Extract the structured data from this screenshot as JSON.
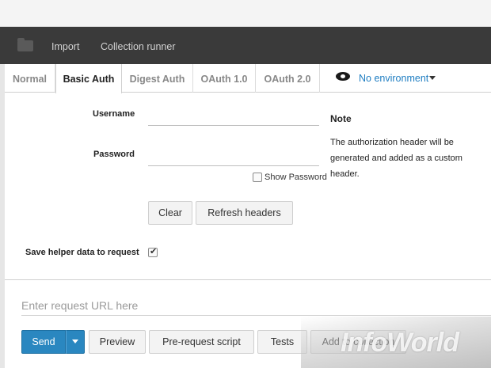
{
  "toolbar": {
    "import_label": "Import",
    "runner_label": "Collection runner"
  },
  "auth_tabs": [
    {
      "label": "Normal",
      "active": false
    },
    {
      "label": "Basic Auth",
      "active": true
    },
    {
      "label": "Digest Auth",
      "active": false
    },
    {
      "label": "OAuth 1.0",
      "active": false
    },
    {
      "label": "OAuth 2.0",
      "active": false
    }
  ],
  "environment": {
    "selected": "No environment",
    "icon": "eye-icon"
  },
  "form": {
    "username_label": "Username",
    "username_value": "",
    "password_label": "Password",
    "password_value": "",
    "show_password_label": "Show Password",
    "show_password_checked": false,
    "clear_label": "Clear",
    "refresh_label": "Refresh headers",
    "save_helper_label": "Save helper data to request",
    "save_helper_checked": true
  },
  "note": {
    "title": "Note",
    "text": "The authorization header will be generated and added as a custom header."
  },
  "request": {
    "url_placeholder": "Enter request URL here",
    "url_value": ""
  },
  "actions": {
    "send_label": "Send",
    "preview_label": "Preview",
    "prerequest_label": "Pre-request script",
    "tests_label": "Tests",
    "add_collection_label": "Add to collection"
  },
  "watermark": "InfoWorld",
  "colors": {
    "toolbar_bg": "#3a3a3a",
    "accent": "#2a87c0",
    "env_link": "#1f7ec2"
  }
}
